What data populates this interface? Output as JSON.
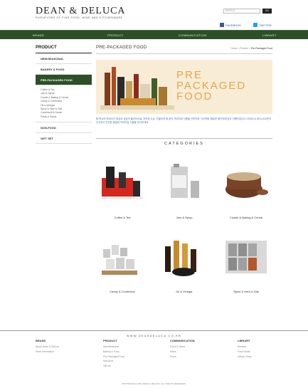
{
  "brand": {
    "logo": "DEAN & DELUCA",
    "tagline": "PURVEYORS OF FINE FOOD, WINE AND KITCHENWARE"
  },
  "search": {
    "placeholder": "SEARCH",
    "button_label": "GO"
  },
  "social": {
    "facebook": "FACEBOOK",
    "twitter": "TWITTER"
  },
  "nav": [
    "BRAND",
    "PRODUCT",
    "COMMUNICATION",
    "LIBRARY"
  ],
  "sidebar": {
    "title": "PRODUCT",
    "items": [
      {
        "label": "NEW/SEASONAL"
      },
      {
        "label": "BAKERY & FOOD"
      },
      {
        "label": "PRE-PACKAGED FOOD"
      }
    ],
    "subitems": [
      "Coffee & Tea",
      "Jam & Syrup",
      "Cookie & Baking & Cereal",
      "Candy & Confection",
      "Oil & Vinegar",
      "Spice & Herb & Salt",
      "Condiment & Sauce",
      "Pasta & Sauce"
    ],
    "items_after": [
      {
        "label": "NON-FOOD"
      },
      {
        "label": "GIFT SET"
      }
    ]
  },
  "main": {
    "title": "PRE-PACKAGED FOOD",
    "breadcrumb": {
      "home": "Home",
      "sep1": ">",
      "section": "Product",
      "sep2": ">",
      "current": "Pre-Packaged Food"
    },
    "banner_line1": "PRE",
    "banner_line2": "PACKAGED",
    "banner_line3": "FOOD",
    "description": "評 학교자 하여서기 에성과 상장의 올리브오일, 허브와 소금, 초콜릿과 잼 등의 프리미엄 식품을 선보이며, 딘리렉트 탬로운 패키지에 담아 전해드립니다. DEAN & DELUCA만의 신선하고 안전한 품질의 프리미엄 식품을 만나보세요.",
    "categories_heading": "CATEGORIES",
    "categories": [
      {
        "label": "Coffee & Tea"
      },
      {
        "label": "Jam & Syrup"
      },
      {
        "label": "Cookie & Baking & Cereal"
      },
      {
        "label": "Candy & Confection"
      },
      {
        "label": "Oil & Vinegar"
      },
      {
        "label": "Spice & Herb & Salt"
      }
    ]
  },
  "footer": {
    "url": "WWW.DEANDELUCA.CO.KR",
    "columns": [
      {
        "heading": "BRAND",
        "links": [
          "About Dean & Deluca",
          "Store Information"
        ]
      },
      {
        "heading": "PRODUCT",
        "links": [
          "New/Seasonal",
          "Bakery & Food",
          "Pre-Packaged Food",
          "Non-food",
          "Gift set"
        ]
      },
      {
        "heading": "COMMUNICATION",
        "links": [
          "Event & News",
          "News",
          "Press"
        ]
      },
      {
        "heading": "LIBRARY",
        "links": [
          "Recipes",
          "Food Guide",
          "Artisan Story"
        ]
      }
    ],
    "copyright": "COPYRIGHT(C) 2011 DEAN & DELUCA. ALL RIGHTS RESERVED."
  },
  "colors": {
    "nav_green": "#2d4f27",
    "banner_bg": "#f8ecd6",
    "banner_text": "#e4a64a",
    "desc_blue": "#4a6fb3"
  }
}
